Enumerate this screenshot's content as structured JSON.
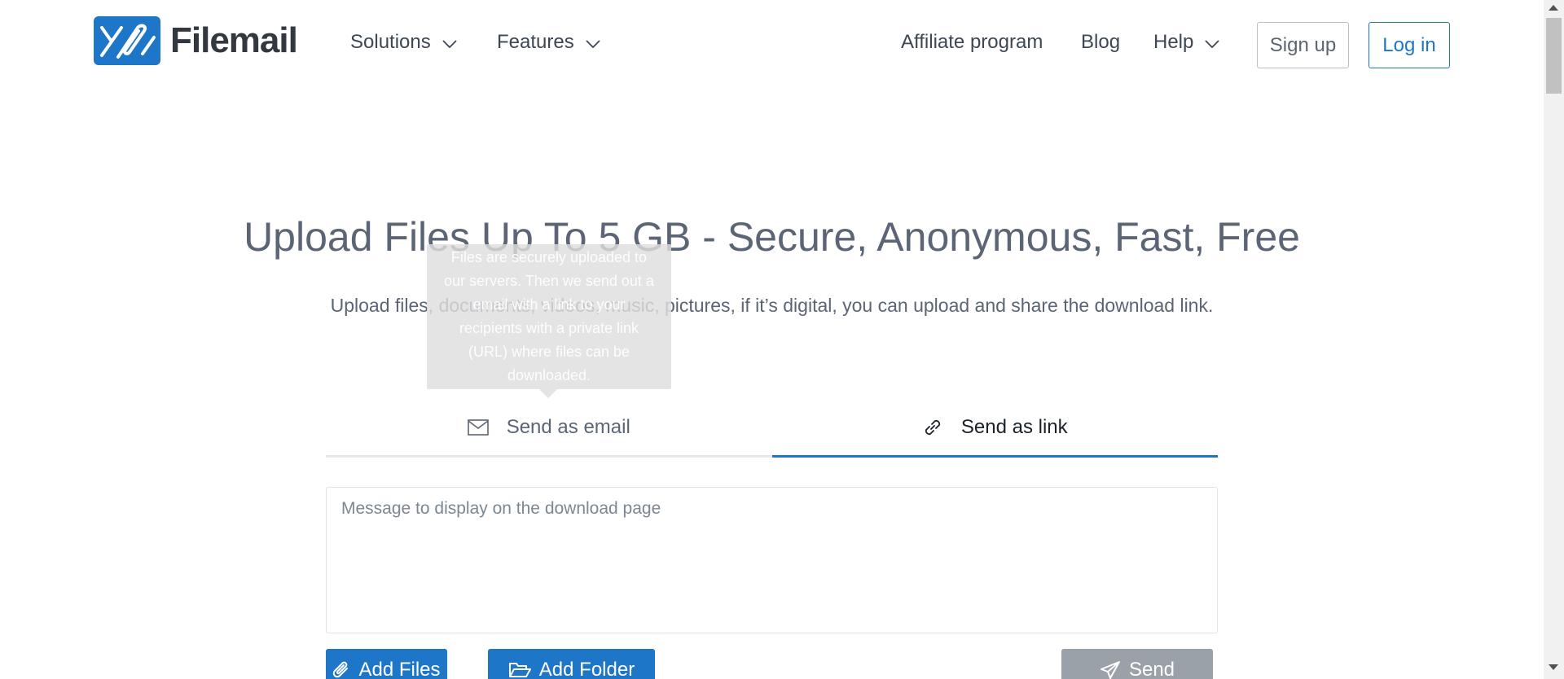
{
  "brand": {
    "name": "Filemail",
    "accent": "#1e76c9"
  },
  "nav": {
    "solutions": "Solutions",
    "features": "Features",
    "affiliate": "Affiliate program",
    "blog": "Blog",
    "help": "Help",
    "signup": "Sign up",
    "login": "Log in"
  },
  "hero": {
    "title": "Upload Files Up To 5 GB - Secure, Anonymous, Fast, Free",
    "subtitle": "Upload files, documents, videos, music, pictures, if it’s digital, you can upload and share the download link."
  },
  "tooltip": {
    "text": "Files are securely uploaded to our servers. Then we send out a email with a link to your recipients with a private link (URL) where files can be downloaded."
  },
  "tabs": [
    {
      "label": "Send as email",
      "icon": "envelope-icon",
      "active": false
    },
    {
      "label": "Send as link",
      "icon": "link-icon",
      "active": true
    }
  ],
  "message": {
    "placeholder": "Message to display on the download page",
    "value": ""
  },
  "actions": {
    "add_files": "Add Files",
    "add_folder": "Add Folder",
    "send": "Send"
  }
}
